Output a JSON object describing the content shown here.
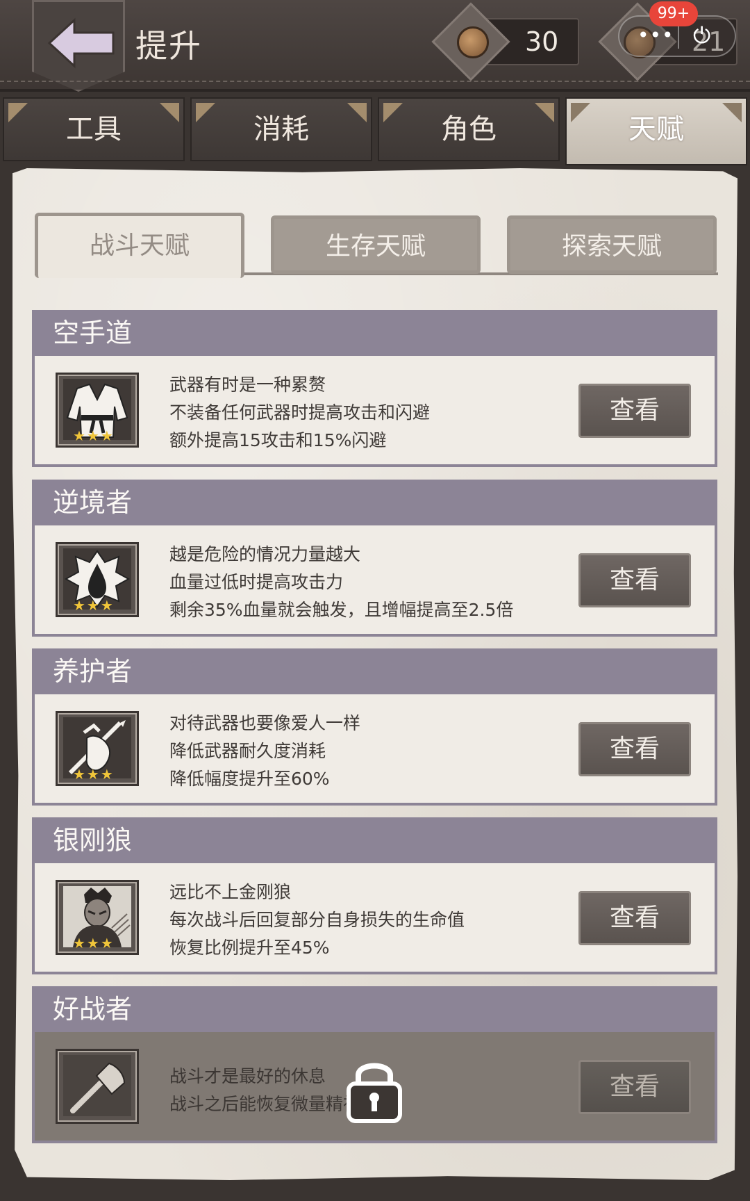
{
  "header": {
    "title": "提升",
    "currency_a": "30",
    "currency_b": "21",
    "notification_badge": "99+"
  },
  "main_tabs": [
    {
      "label": "工具",
      "active": false
    },
    {
      "label": "消耗",
      "active": false
    },
    {
      "label": "角色",
      "active": false
    },
    {
      "label": "天赋",
      "active": true
    }
  ],
  "sub_tabs": [
    {
      "label": "战斗天赋",
      "active": true
    },
    {
      "label": "生存天赋",
      "active": false
    },
    {
      "label": "探索天赋",
      "active": false
    }
  ],
  "talents": [
    {
      "name": "空手道",
      "icon": "karate-gi-icon",
      "stars": "★★★",
      "lines": [
        "武器有时是一种累赘",
        "不装备任何武器时提高攻击和闪避",
        "额外提高15攻击和15%闪避"
      ],
      "button": "查看",
      "locked": false
    },
    {
      "name": "逆境者",
      "icon": "blood-drop-icon",
      "stars": "★★★",
      "lines": [
        "越是危险的情况力量越大",
        "血量过低时提高攻击力",
        "剩余35%血量就会触发，且增幅提高至2.5倍"
      ],
      "button": "查看",
      "locked": false
    },
    {
      "name": "养护者",
      "icon": "spear-hand-icon",
      "stars": "★★★",
      "lines": [
        "对待武器也要像爱人一样",
        "降低武器耐久度消耗",
        "降低幅度提升至60%"
      ],
      "button": "查看",
      "locked": false
    },
    {
      "name": "银刚狼",
      "icon": "wolverine-portrait-icon",
      "stars": "★★★",
      "lines": [
        "远比不上金刚狼",
        "每次战斗后回复部分自身损失的生命值",
        "恢复比例提升至45%"
      ],
      "button": "查看",
      "locked": false
    },
    {
      "name": "好战者",
      "icon": "axe-icon",
      "stars": "",
      "lines": [
        "战斗才是最好的休息",
        "战斗之后能恢复微量精神值"
      ],
      "button": "查看",
      "locked": true
    }
  ],
  "colors": {
    "header_bg": "#3d3633",
    "title_bar": "#8c8496",
    "paper": "#e9e4dc",
    "star": "#f0c53a",
    "badge": "#e8453a"
  }
}
